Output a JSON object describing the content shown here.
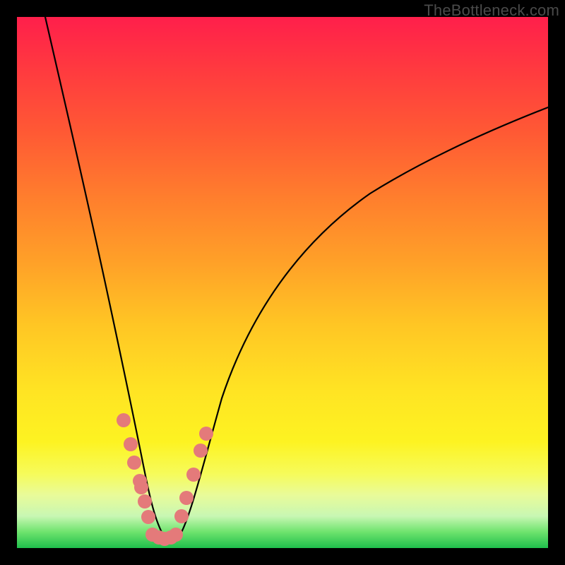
{
  "watermark": "TheBottleneck.com",
  "colors": {
    "point_fill": "#e47a7a",
    "line_stroke": "#000000"
  },
  "chart_data": {
    "type": "line",
    "title": "",
    "xlabel": "",
    "ylabel": "",
    "xlim": [
      0,
      100
    ],
    "ylim": [
      0,
      100
    ],
    "grid": false,
    "legend": false,
    "note": "No axis tick labels are rendered in the image; x and y values are estimated proportionally from pixel positions within the plot area.",
    "series": [
      {
        "name": "left-branch",
        "x": [
          5.3,
          7.3,
          9.3,
          11.3,
          13.3,
          15.3,
          16.6,
          17.9,
          19.1,
          20.1,
          21.3,
          22.1,
          23.0,
          24.0,
          24.6,
          25.5
        ],
        "y": [
          100.0,
          88.4,
          77.5,
          66.8,
          56.3,
          46.4,
          40.2,
          34.2,
          28.5,
          24.3,
          19.5,
          16.2,
          12.8,
          8.6,
          6.0,
          2.4
        ]
      },
      {
        "name": "valley-floor",
        "x": [
          25.5,
          26.6,
          27.7,
          28.7,
          29.8
        ],
        "y": [
          2.4,
          1.9,
          1.7,
          1.9,
          2.4
        ]
      },
      {
        "name": "right-branch",
        "x": [
          29.8,
          30.9,
          31.9,
          33.2,
          34.6,
          35.9,
          38.6,
          41.2,
          45.2,
          50.5,
          55.9,
          61.2,
          66.5,
          73.1,
          79.8,
          86.4,
          93.1,
          100.0
        ],
        "y": [
          2.4,
          5.8,
          9.2,
          13.8,
          18.4,
          22.4,
          29.9,
          36.3,
          44.3,
          52.8,
          59.4,
          64.6,
          69.0,
          73.3,
          76.7,
          79.4,
          81.5,
          83.0
        ]
      }
    ],
    "points": {
      "name": "highlighted-data-points",
      "x": [
        20.1,
        21.4,
        22.1,
        23.1,
        23.4,
        24.1,
        24.7,
        25.5,
        26.7,
        27.8,
        29.0,
        29.9,
        31.0,
        31.9,
        33.2,
        34.6,
        35.6
      ],
      "y": [
        24.1,
        19.5,
        16.1,
        12.6,
        11.4,
        8.8,
        5.9,
        2.5,
        2.0,
        1.7,
        2.0,
        2.5,
        6.0,
        9.4,
        13.8,
        18.4,
        21.5
      ]
    }
  }
}
